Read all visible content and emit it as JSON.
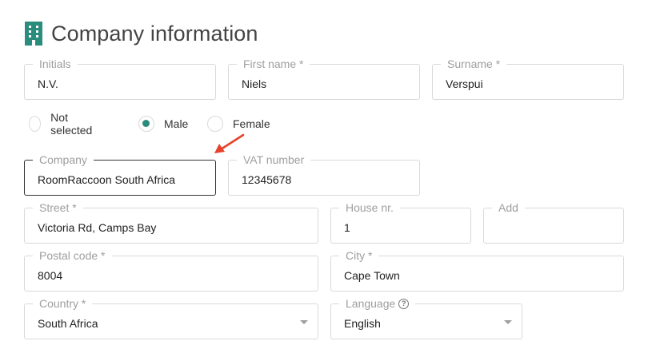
{
  "header": {
    "title": "Company information",
    "icon": "building-icon",
    "icon_color": "#2a8c7c"
  },
  "fields": {
    "initials": {
      "label": "Initials",
      "value": "N.V."
    },
    "first_name": {
      "label": "First name *",
      "value": "Niels"
    },
    "surname": {
      "label": "Surname *",
      "value": "Verspui"
    },
    "company": {
      "label": "Company",
      "value": "RoomRaccoon South Africa"
    },
    "vat": {
      "label": "VAT number",
      "value": "12345678"
    },
    "street": {
      "label": "Street *",
      "value": "Victoria Rd, Camps Bay"
    },
    "house_nr": {
      "label": "House nr.",
      "value": "1"
    },
    "add": {
      "label": "Add",
      "value": ""
    },
    "postal_code": {
      "label": "Postal code *",
      "value": "8004"
    },
    "city": {
      "label": "City *",
      "value": "Cape Town"
    },
    "country": {
      "label": "Country *",
      "value": "South Africa"
    },
    "language": {
      "label": "Language",
      "value": "English"
    }
  },
  "gender": {
    "options": [
      "Not selected",
      "Male",
      "Female"
    ],
    "selected": "Male",
    "accent": "#2a8c7c"
  },
  "annotation": {
    "arrow_color": "#e8412c"
  }
}
